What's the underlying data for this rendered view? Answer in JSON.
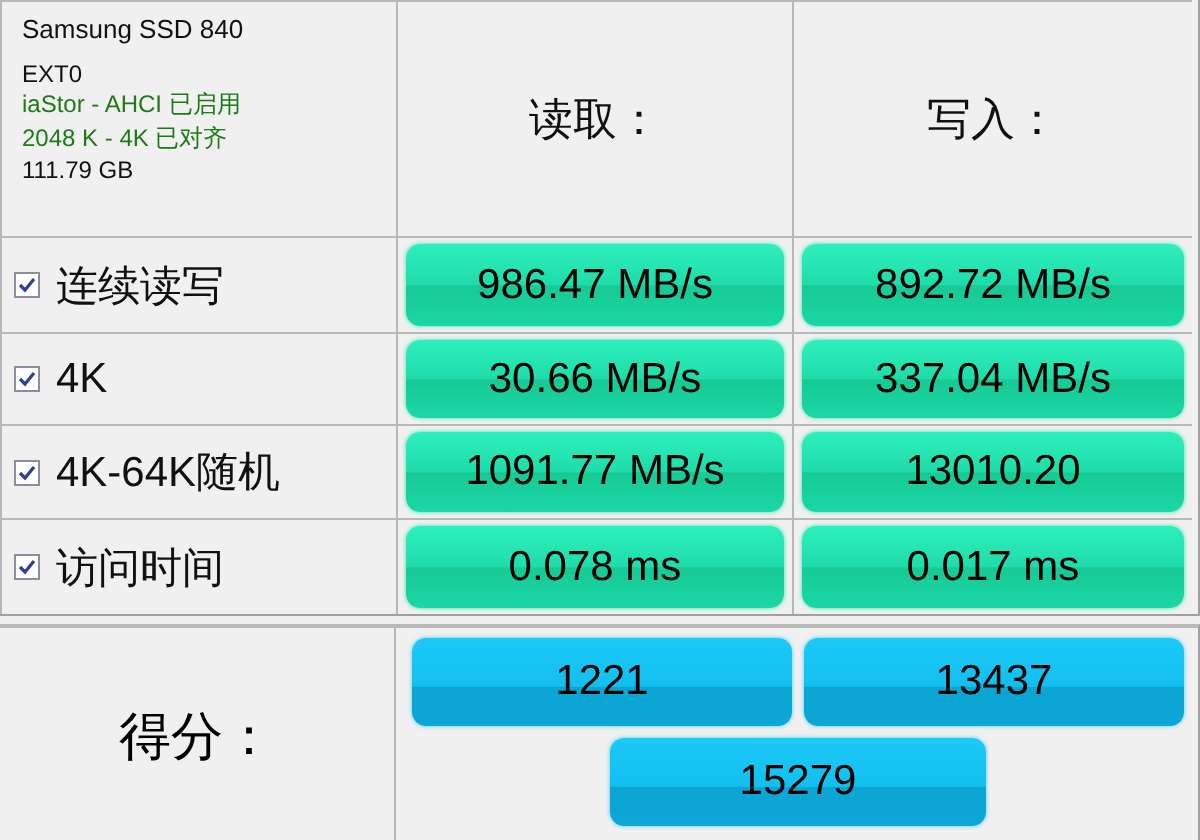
{
  "drive": {
    "model": "Samsung SSD 840",
    "firmware": "EXT0",
    "driver": "iaStor - AHCI 已启用",
    "alignment": "2048 K - 4K 已对齐",
    "size": "111.79 GB"
  },
  "columns": [
    "读取：",
    "写入："
  ],
  "tests": [
    {
      "name": "连续读写",
      "checked": true,
      "read": "986.47 MB/s",
      "write": "892.72 MB/s"
    },
    {
      "name": "4K",
      "checked": true,
      "read": "30.66 MB/s",
      "write": "337.04 MB/s"
    },
    {
      "name": "4K-64K随机",
      "checked": true,
      "read": "1091.77 MB/s",
      "write": "13010.20"
    },
    {
      "name": "访问时间",
      "checked": true,
      "read": "0.078 ms",
      "write": "0.017 ms"
    }
  ],
  "score": {
    "label": "得分：",
    "read": "1221",
    "write": "13437",
    "total": "15279"
  }
}
